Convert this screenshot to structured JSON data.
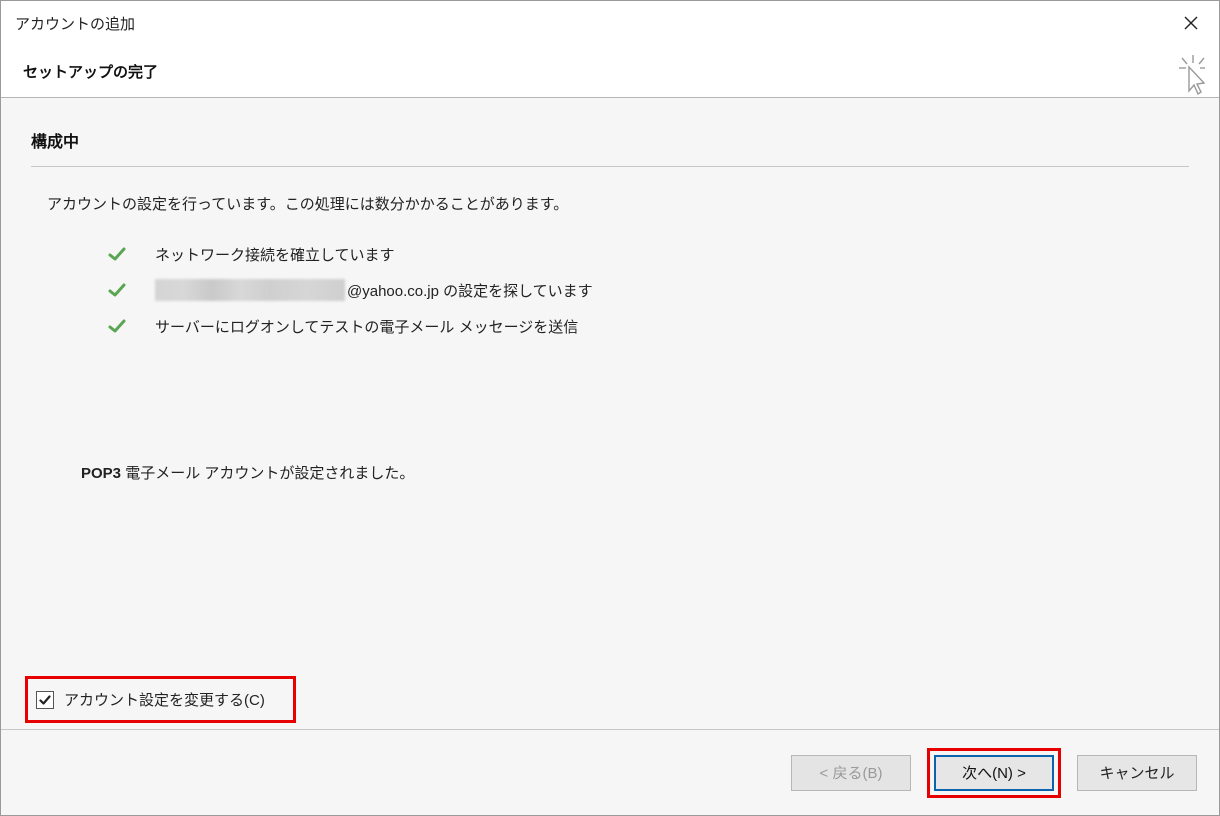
{
  "window": {
    "title": "アカウントの追加",
    "subtitle": "セットアップの完了"
  },
  "section": {
    "heading": "構成中",
    "description": "アカウントの設定を行っています。この処理には数分かかることがあります。"
  },
  "steps": [
    {
      "text": "ネットワーク接続を確立しています",
      "redacted": false
    },
    {
      "text": "@yahoo.co.jp の設定を探しています",
      "redacted": true
    },
    {
      "text": "サーバーにログオンしてテストの電子メール メッセージを送信",
      "redacted": false
    }
  ],
  "result": {
    "prefix": "POP3",
    "text": " 電子メール アカウントが設定されました。"
  },
  "checkbox": {
    "label": "アカウント設定を変更する(C)",
    "checked": true
  },
  "buttons": {
    "back": "< 戻る(B)",
    "next": "次へ(N) >",
    "cancel": "キャンセル"
  }
}
